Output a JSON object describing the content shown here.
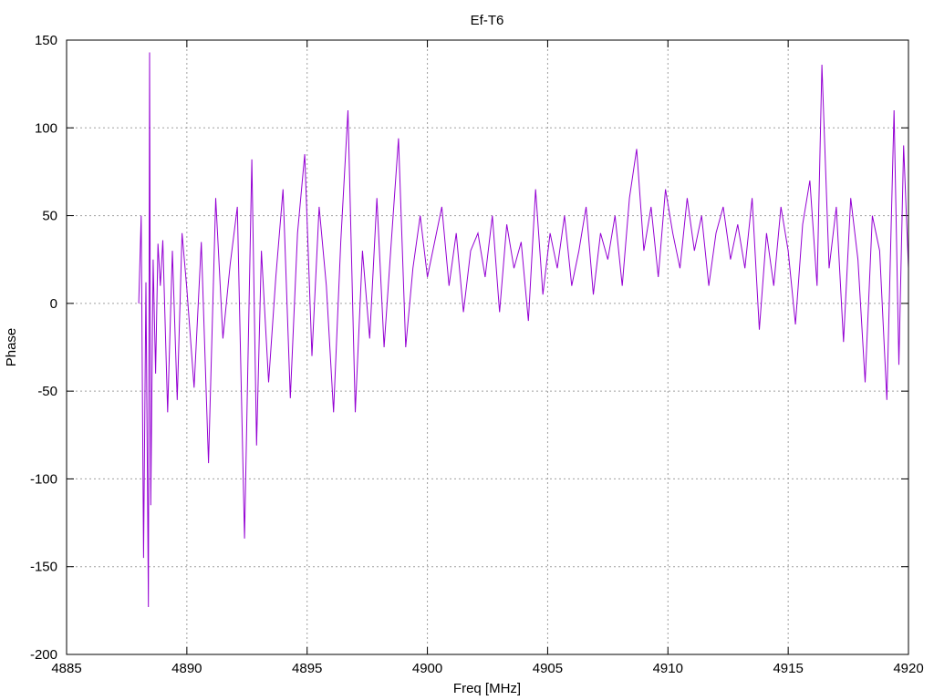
{
  "chart_data": {
    "type": "line",
    "title": "Ef-T6",
    "xlabel": "Freq [MHz]",
    "ylabel": "Phase",
    "xlim": [
      4885,
      4920
    ],
    "ylim": [
      -200,
      150
    ],
    "xticks": [
      4885,
      4890,
      4895,
      4900,
      4905,
      4910,
      4915,
      4920
    ],
    "yticks": [
      -200,
      -150,
      -100,
      -50,
      0,
      50,
      100,
      150
    ],
    "grid": true,
    "legend": "none",
    "line_color": "#9400d3",
    "series": [
      {
        "x": [
          4888.0,
          4888.1,
          4888.2,
          4888.3,
          4888.4,
          4888.45,
          4888.5,
          4888.6,
          4888.7,
          4888.8,
          4888.9,
          4889.0,
          4889.2,
          4889.4,
          4889.6,
          4889.8,
          4890.0,
          4890.3,
          4890.6,
          4890.9,
          4891.2,
          4891.5,
          4891.8,
          4892.1,
          4892.4,
          4892.7,
          4892.9,
          4893.1,
          4893.4,
          4893.7,
          4894.0,
          4894.3,
          4894.6,
          4894.9,
          4895.2,
          4895.5,
          4895.8,
          4896.1,
          4896.4,
          4896.7,
          4897.0,
          4897.3,
          4897.6,
          4897.9,
          4898.2,
          4898.5,
          4898.8,
          4899.1,
          4899.4,
          4899.7,
          4900.0,
          4900.3,
          4900.6,
          4900.9,
          4901.2,
          4901.5,
          4901.8,
          4902.1,
          4902.4,
          4902.7,
          4903.0,
          4903.3,
          4903.6,
          4903.9,
          4904.2,
          4904.5,
          4904.8,
          4905.1,
          4905.4,
          4905.7,
          4906.0,
          4906.3,
          4906.6,
          4906.9,
          4907.2,
          4907.5,
          4907.8,
          4908.1,
          4908.4,
          4908.7,
          4909.0,
          4909.3,
          4909.6,
          4909.9,
          4910.2,
          4910.5,
          4910.8,
          4911.1,
          4911.4,
          4911.7,
          4912.0,
          4912.3,
          4912.6,
          4912.9,
          4913.2,
          4913.5,
          4913.8,
          4914.1,
          4914.4,
          4914.7,
          4915.0,
          4915.3,
          4915.6,
          4915.9,
          4916.2,
          4916.4,
          4916.7,
          4917.0,
          4917.3,
          4917.6,
          4917.9,
          4918.2,
          4918.5,
          4918.8,
          4919.1,
          4919.4,
          4919.6,
          4919.8,
          4920.0
        ],
        "values": [
          0,
          50,
          -145,
          12,
          -173,
          143,
          -115,
          25,
          -40,
          34,
          10,
          36,
          -62,
          30,
          -55,
          40,
          8,
          -48,
          35,
          -91,
          60,
          -20,
          22,
          55,
          -134,
          82,
          -81,
          30,
          -45,
          15,
          65,
          -54,
          40,
          85,
          -30,
          55,
          10,
          -62,
          35,
          110,
          -62,
          30,
          -20,
          60,
          -25,
          35,
          94,
          -25,
          20,
          50,
          15,
          35,
          55,
          10,
          40,
          -5,
          30,
          40,
          15,
          50,
          -5,
          45,
          20,
          35,
          -10,
          65,
          5,
          40,
          20,
          50,
          10,
          30,
          55,
          5,
          40,
          25,
          50,
          10,
          60,
          88,
          30,
          55,
          15,
          65,
          40,
          20,
          60,
          30,
          50,
          10,
          40,
          55,
          25,
          45,
          20,
          60,
          -15,
          40,
          10,
          55,
          30,
          -12,
          45,
          70,
          10,
          136,
          20,
          55,
          -22,
          60,
          25,
          -45,
          50,
          30,
          -55,
          110,
          -35,
          90,
          20
        ]
      }
    ]
  }
}
